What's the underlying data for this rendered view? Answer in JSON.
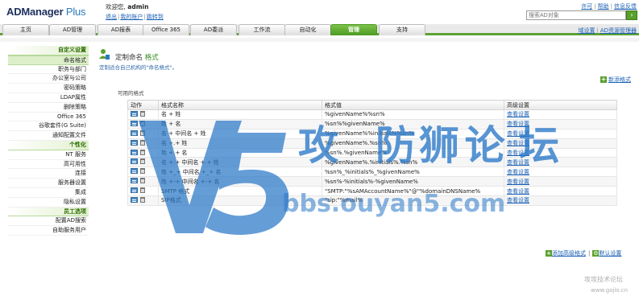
{
  "header": {
    "logo_main": "ADManager",
    "logo_plus": " Plus",
    "welcome_prefix": "欢迎您, ",
    "user": "admin",
    "links": [
      "退出",
      "我的账户",
      "跳转到"
    ],
    "top_links": [
      "许可",
      "帮助",
      "信息反馈"
    ],
    "search_placeholder": "搜索AD对象"
  },
  "nav": {
    "tabs": [
      "主页",
      "AD管理",
      "AD报表",
      "Office 365",
      "AD委派",
      "工作流",
      "自动化",
      "管理",
      "支持"
    ],
    "active_tab": "管理",
    "right_links": [
      "域设置",
      "AD资源管理器"
    ]
  },
  "sidebar": [
    {
      "label": "自定义设置",
      "type": "head"
    },
    {
      "label": "命名格式",
      "type": "active"
    },
    {
      "label": "职务与部门",
      "type": "item"
    },
    {
      "label": "办公室与公司",
      "type": "item"
    },
    {
      "label": "密码策略",
      "type": "item"
    },
    {
      "label": "LDAP属性",
      "type": "item"
    },
    {
      "label": "删除策略",
      "type": "item"
    },
    {
      "label": "Office 365",
      "type": "item"
    },
    {
      "label": "谷歌套件(G Suite)",
      "type": "item"
    },
    {
      "label": "通知配置文件",
      "type": "item"
    },
    {
      "label": "个性化",
      "type": "head"
    },
    {
      "label": "NT 服务",
      "type": "item"
    },
    {
      "label": "高可用性",
      "type": "item"
    },
    {
      "label": "连接",
      "type": "item"
    },
    {
      "label": "服务器设置",
      "type": "item"
    },
    {
      "label": "集成",
      "type": "item"
    },
    {
      "label": "隐私设置",
      "type": "item"
    },
    {
      "label": "员工选项",
      "type": "head"
    },
    {
      "label": "配置AD搜索",
      "type": "item"
    },
    {
      "label": "自助服务用户",
      "type": "item"
    }
  ],
  "main": {
    "title": "定制命名",
    "title_sub": "格式",
    "description": "定制适合自己机构的\"命名格式\"。",
    "new_format": "新添格式",
    "section_label": "可用的格式",
    "columns": [
      "动作",
      "格式名称",
      "格式值",
      "高级设置"
    ],
    "rows": [
      {
        "name": "名 + 姓",
        "value": "%givenName%%sn%",
        "adv": "查看设置"
      },
      {
        "name": "姓 + 名",
        "value": "%sn%%givenName%",
        "adv": "查看设置"
      },
      {
        "name": "名 + 中间名 + 姓",
        "value": "%givenName%%initials%%sn%",
        "adv": "查看设置"
      },
      {
        "name": "名 +.+ 姓",
        "value": "%givenName%.%sn%",
        "adv": "查看设置"
      },
      {
        "name": "姓 +.+ 名",
        "value": "%sn%.%givenName%",
        "adv": "查看设置"
      },
      {
        "name": "名 +.+ 中间名 +.+ 姓",
        "value": "%givenName%.%initials%.%sn%",
        "adv": "查看设置"
      },
      {
        "name": "姓 +_+ 中间名 +_+ 名",
        "value": "%sn%_%initials%_%givenName%",
        "adv": "查看设置"
      },
      {
        "name": "姓 +-+ 中间名 +-+ 名",
        "value": "%sn%-%initials%-%givenName%",
        "adv": "查看设置"
      },
      {
        "name": "SMTP 格式",
        "value": "\"SMTP:\"%sAMAccountName%\"@\"%domainDNSName%",
        "adv": "查看设置"
      },
      {
        "name": "SIP格式",
        "value": "\"sip:\"%mail%",
        "adv": "查看设置"
      }
    ],
    "bottom_links": [
      "添加高级格式",
      "默认设置"
    ]
  },
  "watermark": {
    "big": "攻         论 坛",
    "url": "bbs.ouyan5.com",
    "corner": "攻攻技术论坛",
    "corner_url": "www.gojio.cn"
  },
  "colors": {
    "accent": "#5da234",
    "link": "#1a5fb4",
    "watermark": "#2a78c8"
  }
}
